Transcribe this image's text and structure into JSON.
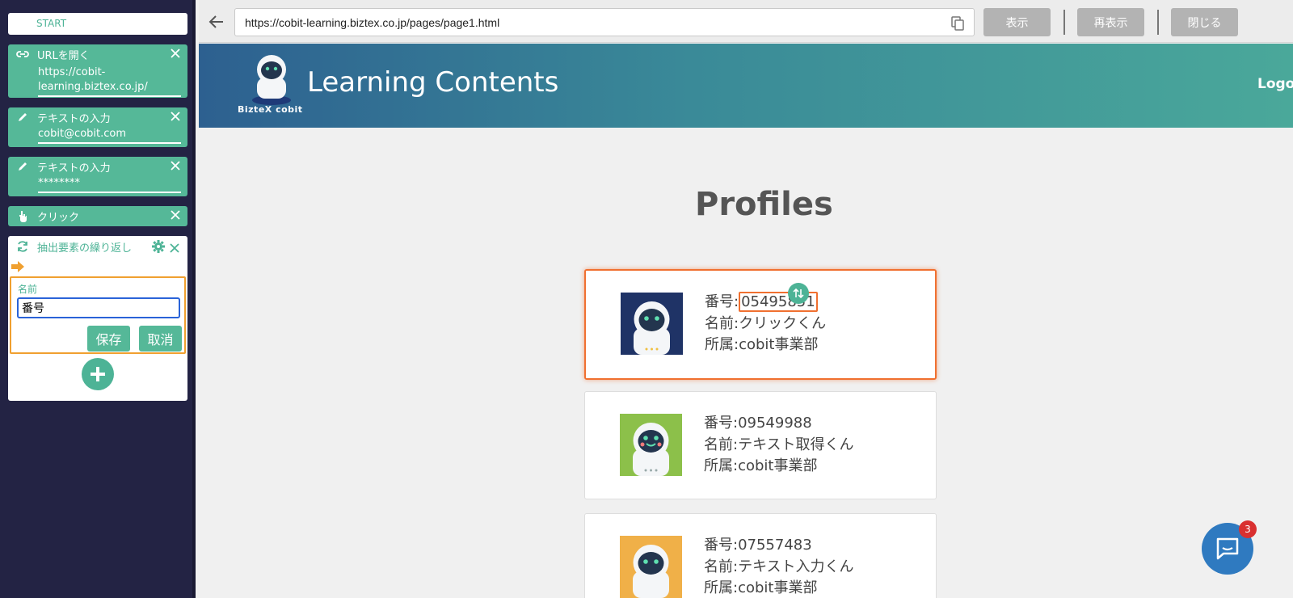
{
  "sidebar": {
    "start_label": "START",
    "steps": [
      {
        "title": "URLを開く",
        "icon": "link-icon",
        "value": "https://cobit-learning.biztex.co.jp/"
      },
      {
        "title": "テキストの入力",
        "icon": "pencil-icon",
        "value": "cobit@cobit.com"
      },
      {
        "title": "テキストの入力",
        "icon": "pencil-icon",
        "value": "********"
      },
      {
        "title": "クリック",
        "icon": "pointer-hand-icon"
      }
    ],
    "loop": {
      "title": "抽出要素の繰り返し",
      "name_label": "名前",
      "name_value": "番号",
      "save_label": "保存",
      "cancel_label": "取消"
    }
  },
  "browser": {
    "url": "https://cobit-learning.biztex.co.jp/pages/page1.html",
    "buttons": {
      "show": "表示",
      "reload": "再表示",
      "close": "閉じる"
    }
  },
  "page": {
    "brand": "BizteX cobit",
    "title": "Learning Contents",
    "logout": "Logout",
    "heading": "Profiles",
    "profiles": [
      {
        "id_label": "番号:",
        "id": "05495851",
        "name": "名前:クリックくん",
        "dept": "所属:cobit事業部",
        "avatar_bg": "#1f3366"
      },
      {
        "id_label": "番号:",
        "id": "09549988",
        "name": "名前:テキスト取得くん",
        "dept": "所属:cobit事業部",
        "avatar_bg": "#8cc04a"
      },
      {
        "id_label": "番号:",
        "id": "07557483",
        "name": "名前:テキスト入力くん",
        "dept": "所属:cobit事業部",
        "avatar_bg": "#f0b048"
      }
    ]
  },
  "chat": {
    "badge_count": "3"
  },
  "colors": {
    "accent": "#55b898",
    "sidebar_bg": "#232344",
    "highlight": "#f07030"
  }
}
